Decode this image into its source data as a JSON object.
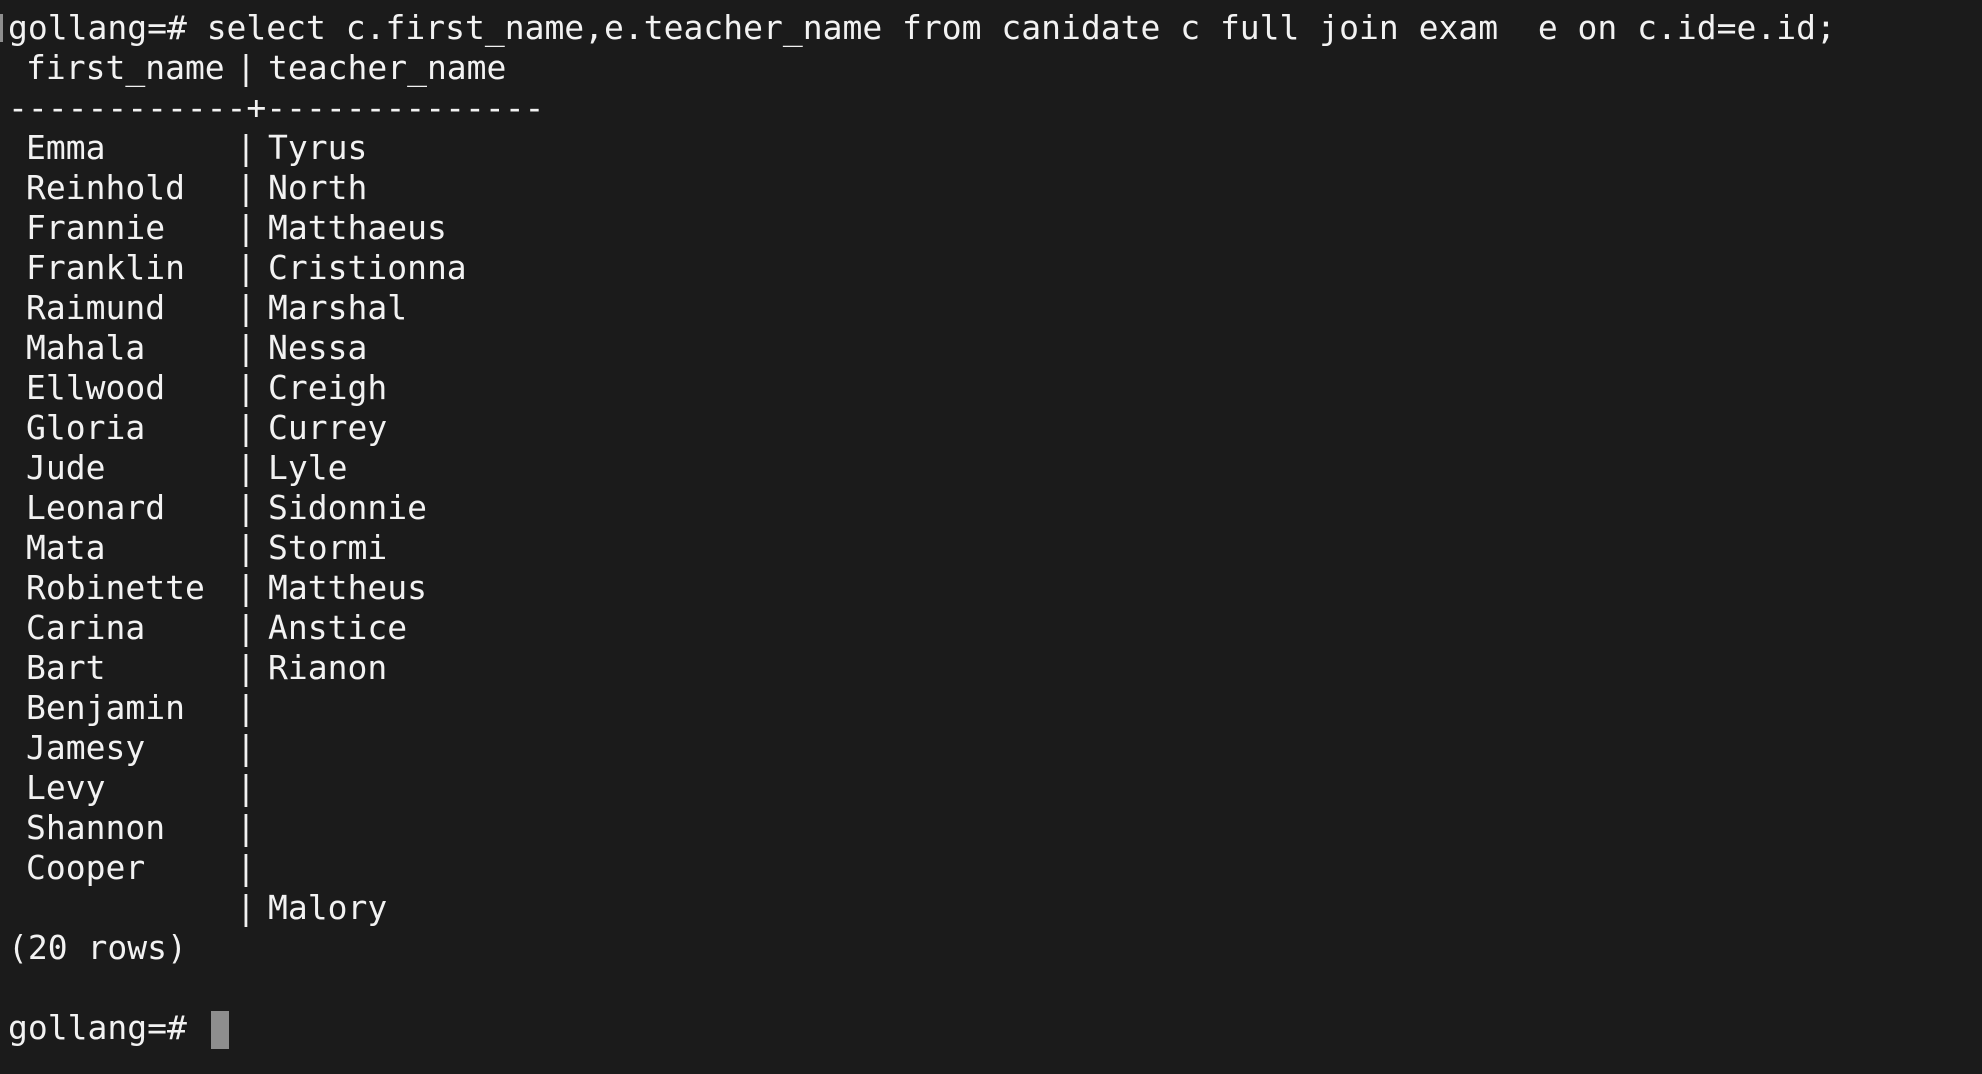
{
  "terminal": {
    "prompt": "gollang=#",
    "command": "select c.first_name,e.teacher_name from canidate c full join exam  e on c.id=e.id;",
    "header": {
      "col1": "first_name",
      "sep": "|",
      "col2": "teacher_name"
    },
    "divider": "------------+--------------",
    "rows": [
      {
        "first_name": "Emma",
        "teacher_name": "Tyrus"
      },
      {
        "first_name": "Reinhold",
        "teacher_name": "North"
      },
      {
        "first_name": "Frannie",
        "teacher_name": "Matthaeus"
      },
      {
        "first_name": "Franklin",
        "teacher_name": "Cristionna"
      },
      {
        "first_name": "Raimund",
        "teacher_name": "Marshal"
      },
      {
        "first_name": "Mahala",
        "teacher_name": "Nessa"
      },
      {
        "first_name": "Ellwood",
        "teacher_name": "Creigh"
      },
      {
        "first_name": "Gloria",
        "teacher_name": "Currey"
      },
      {
        "first_name": "Jude",
        "teacher_name": "Lyle"
      },
      {
        "first_name": "Leonard",
        "teacher_name": "Sidonnie"
      },
      {
        "first_name": "Mata",
        "teacher_name": "Stormi"
      },
      {
        "first_name": "Robinette",
        "teacher_name": "Mattheus"
      },
      {
        "first_name": "Carina",
        "teacher_name": "Anstice"
      },
      {
        "first_name": "Bart",
        "teacher_name": "Rianon"
      },
      {
        "first_name": "Benjamin",
        "teacher_name": ""
      },
      {
        "first_name": "Jamesy",
        "teacher_name": ""
      },
      {
        "first_name": "Levy",
        "teacher_name": ""
      },
      {
        "first_name": "Shannon",
        "teacher_name": ""
      },
      {
        "first_name": "Cooper",
        "teacher_name": ""
      },
      {
        "first_name": "",
        "teacher_name": "Malory"
      }
    ],
    "row_separator": "|",
    "footer": "(20 rows)",
    "final_prompt": "gollang=#"
  }
}
